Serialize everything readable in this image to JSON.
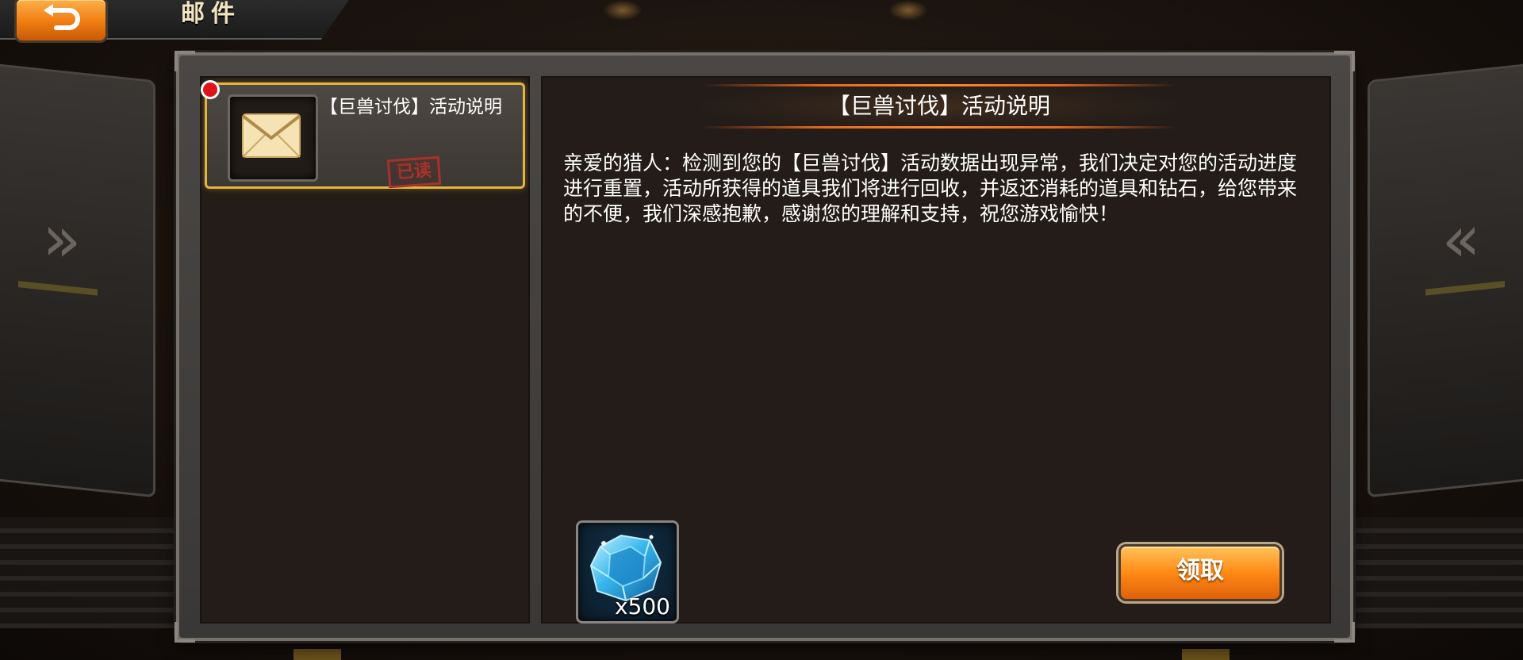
{
  "header": {
    "title": "邮件",
    "back_icon": "back-arrow-icon"
  },
  "mail_list": {
    "items": [
      {
        "title": "【巨兽讨伐】活动说明",
        "status_stamp": "已读",
        "icon": "envelope-icon",
        "unread_dot": true
      }
    ]
  },
  "content": {
    "title": "【巨兽讨伐】活动说明",
    "body": "亲爱的猎人：检测到您的【巨兽讨伐】活动数据出现异常，我们决定对您的活动进度进行重置，活动所获得的道具我们将进行回收，并返还消耗的道具和钻石，给您带来的不便，我们深感抱歉，感谢您的理解和支持，祝您游戏愉快！",
    "reward": {
      "icon": "diamond-icon",
      "quantity": "x500"
    },
    "claim_button": "领取"
  },
  "colors": {
    "accent_orange": "#ff8a15",
    "highlight_gold": "#e3b53d",
    "unread_red": "#e0121a"
  }
}
